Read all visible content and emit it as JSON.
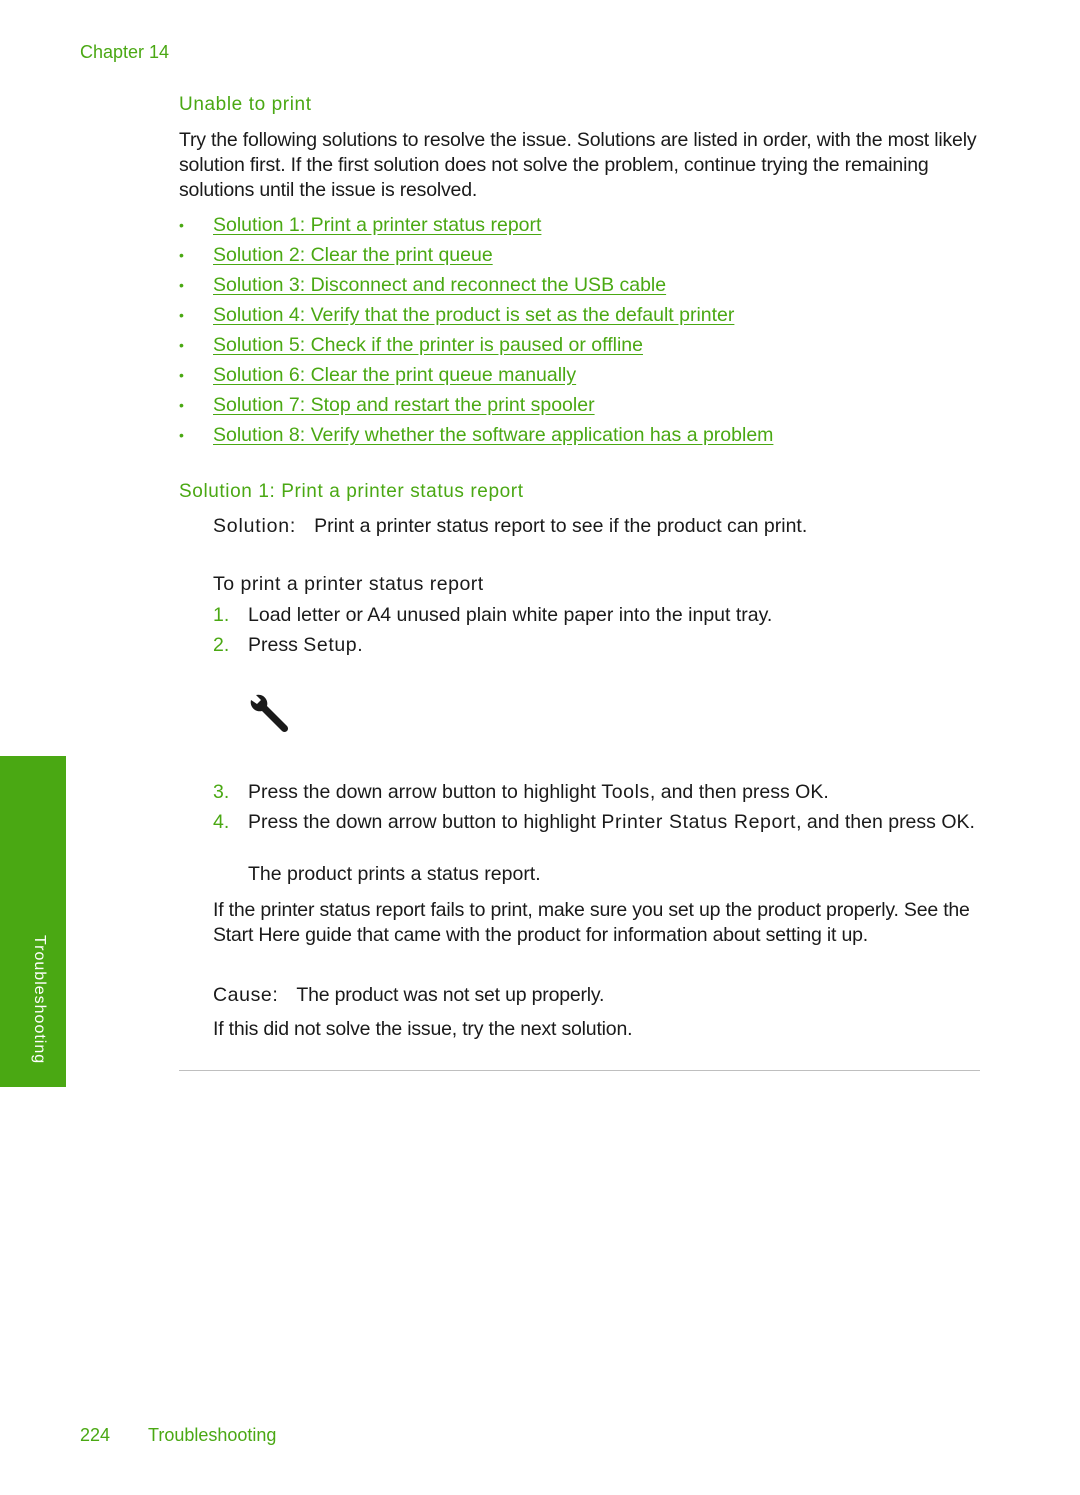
{
  "header": {
    "chapter": "Chapter 14"
  },
  "section": {
    "title": "Unable to print",
    "intro": "Try the following solutions to resolve the issue. Solutions are listed in order, with the most likely solution first. If the first solution does not solve the problem, continue trying the remaining solutions until the issue is resolved.",
    "bullet": "•",
    "solutions": [
      "Solution 1: Print a printer status report",
      "Solution 2: Clear the print queue",
      "Solution 3: Disconnect and reconnect the USB cable",
      "Solution 4: Verify that the product is set as the default printer",
      "Solution 5: Check if the printer is paused or offline",
      "Solution 6: Clear the print queue manually",
      "Solution 7: Stop and restart the print spooler",
      "Solution 8: Verify whether the software application has a problem"
    ]
  },
  "solution1": {
    "title": "Solution 1: Print a printer status report",
    "solution_label": "Solution:",
    "solution_text": "Print a printer status report to see if the product can print.",
    "procedure_title": "To print a printer status report",
    "steps": [
      {
        "num": "1.",
        "text": "Load letter or A4 unused plain white paper into the input tray."
      },
      {
        "num": "2.",
        "pre": "Press ",
        "ui": "Setup",
        "post": "."
      },
      {
        "num": "3.",
        "pre": "Press the down arrow button to highlight ",
        "ui": "Tools",
        "post": ", and then press OK."
      },
      {
        "num": "4.",
        "pre": "Press the down arrow button to highlight ",
        "ui": "Printer Status Report",
        "post": ", and then press OK."
      }
    ],
    "setup_icon": "wrench-icon",
    "step4_note": "The product prints a status report.",
    "fail_para": "If the printer status report fails to print, make sure you set up the product properly. See the Start Here guide that came with the product for information about setting it up.",
    "cause_label": "Cause:",
    "cause_text": "The product was not set up properly.",
    "next_text": "If this did not solve the issue, try the next solution."
  },
  "side_tab": {
    "label": "Troubleshooting"
  },
  "footer": {
    "page_number": "224",
    "section": "Troubleshooting"
  },
  "colors": {
    "accent": "#4aa813",
    "text": "#1a1a1a",
    "rule": "#bfbfbf"
  }
}
